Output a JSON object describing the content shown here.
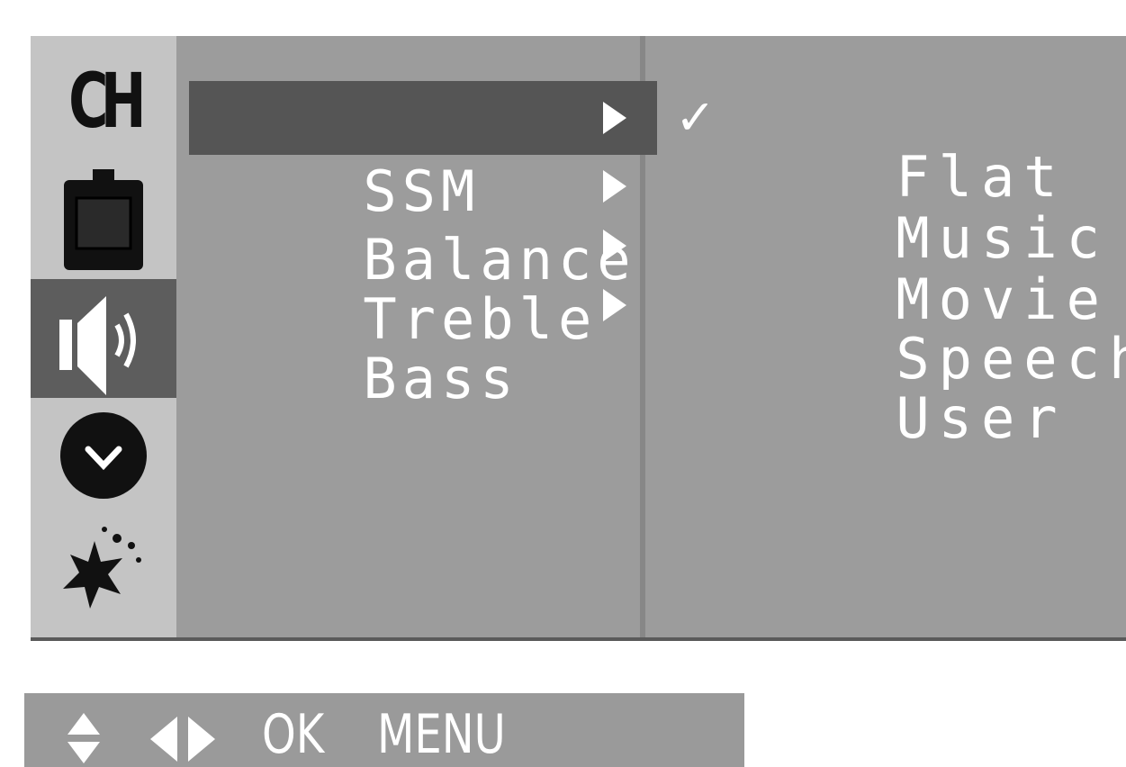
{
  "sidebar": {
    "icons": [
      {
        "name": "ch-icon",
        "label": "CH",
        "active": false
      },
      {
        "name": "tv-icon",
        "active": false
      },
      {
        "name": "speaker-icon",
        "active": true
      },
      {
        "name": "clock-icon",
        "active": false
      },
      {
        "name": "special-icon",
        "active": false
      }
    ]
  },
  "menu": {
    "items": [
      {
        "label": "SSM",
        "selected": true
      },
      {
        "label": "Balance",
        "selected": false
      },
      {
        "label": "Treble",
        "selected": false
      },
      {
        "label": "Bass",
        "selected": false
      }
    ]
  },
  "submenu": {
    "check": "✓",
    "options": [
      {
        "label": "Flat",
        "checked": true
      },
      {
        "label": "Music",
        "checked": false
      },
      {
        "label": "Movie",
        "checked": false
      },
      {
        "label": "Speech",
        "checked": false
      },
      {
        "label": "User",
        "checked": false
      }
    ]
  },
  "help": {
    "ok_label": "OK",
    "menu_label": "MENU"
  },
  "colors": {
    "panel": "#9c9c9c",
    "icon_strip": "#c4c4c4",
    "highlight": "#555555",
    "text": "#ffffff"
  }
}
